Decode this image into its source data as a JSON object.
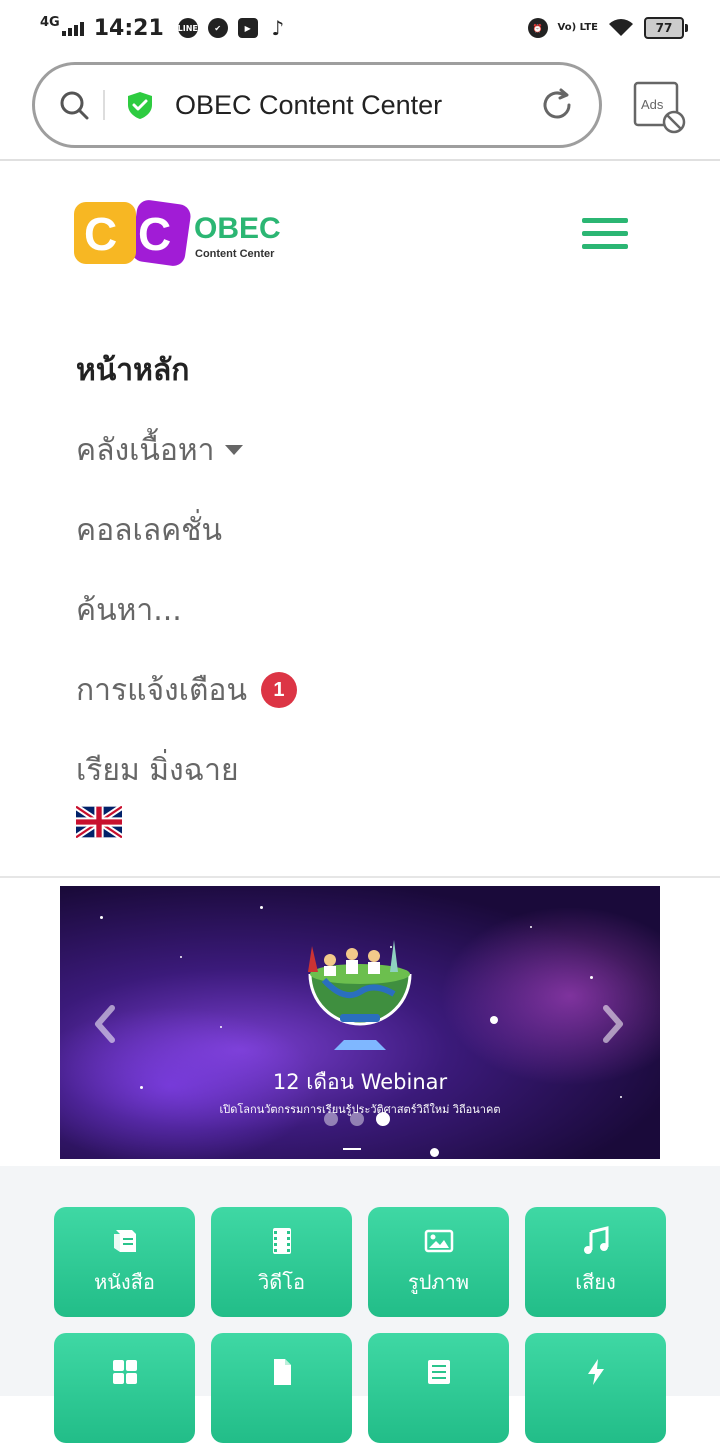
{
  "status_bar": {
    "network": "4G",
    "time": "14:21",
    "lte": "Vo) LTE",
    "battery": "77"
  },
  "browser": {
    "title": "OBEC Content Center",
    "ads_label": "Ads"
  },
  "site": {
    "logo_main": "OBEC",
    "logo_sub": "Content Center",
    "brand_color": "#2bb673"
  },
  "menu": {
    "home": "หน้าหลัก",
    "content": "คลังเนื้อหา",
    "collection": "คอลเลคชั่น",
    "search": "ค้นหา...",
    "notifications": "การแจ้งเตือน",
    "notification_count": "1",
    "user": "เรียม มิ่งฉาย"
  },
  "carousel": {
    "title": "12 เดือน Webinar",
    "subtitle": "เปิดโลกนวัตกรรมการเรียนรู้ประวัติศาสตร์วิถีใหม่ วิถีอนาคต",
    "slide_count": 3,
    "active_slide": 3
  },
  "categories": {
    "book": "หนังสือ",
    "video": "วิดีโอ",
    "image": "รูปภาพ",
    "audio": "เสียง"
  }
}
